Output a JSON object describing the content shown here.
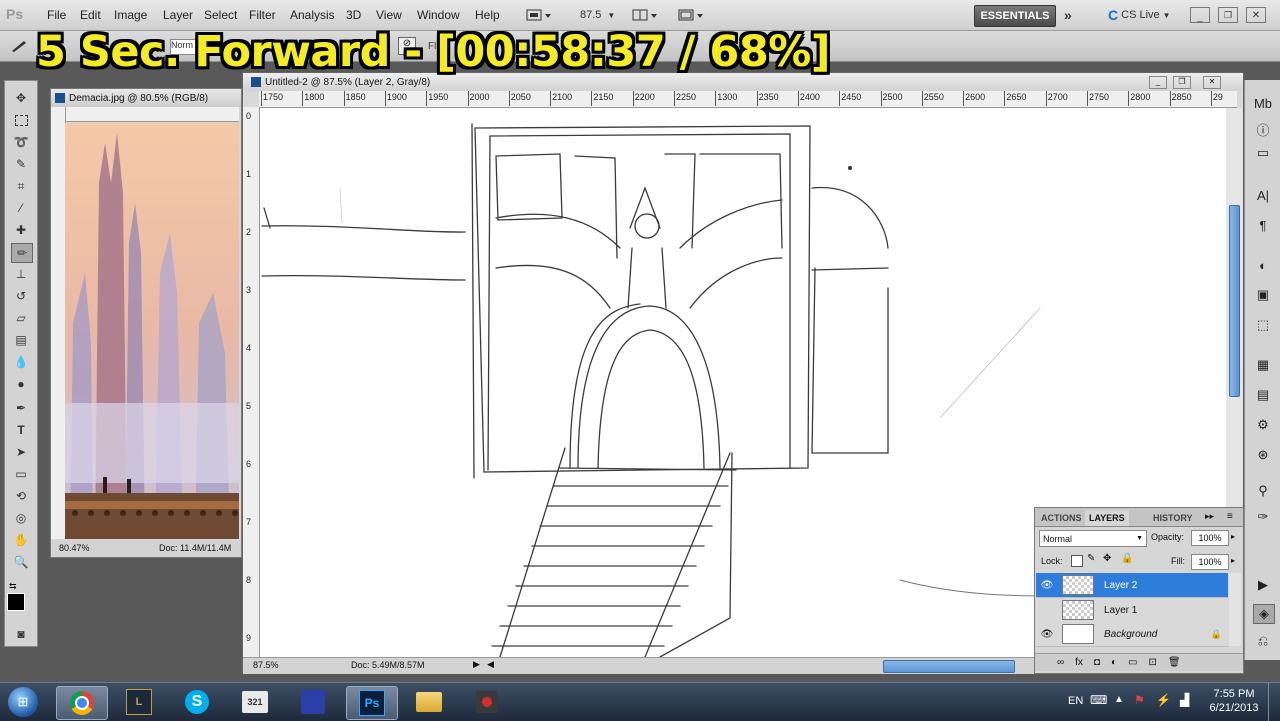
{
  "overlay": {
    "text": "5 Sec. Forward - [00:58:37 / 68%]"
  },
  "menubar": {
    "logo": "Ps",
    "items": [
      "File",
      "Edit",
      "Image",
      "Layer",
      "Select",
      "Filter",
      "Analysis",
      "3D",
      "View",
      "Window",
      "Help"
    ],
    "zoom": "87.5",
    "workspace": "ESSENTIALS",
    "cslive": "CS Live"
  },
  "optbar": {
    "mode": "Norm",
    "flow": "Flo"
  },
  "reference_window": {
    "title": "Demacia.jpg @ 80.5% (RGB/8)",
    "zoom": "80.47%",
    "doc": "Doc: 11.4M/11.4M"
  },
  "document_window": {
    "title": "Untitled-2 @ 87.5% (Layer 2, Gray/8)",
    "zoom": "87.5%",
    "doc": "Doc: 5.49M/8.57M",
    "ruler_labels": [
      "1750",
      "1800",
      "1850",
      "1900",
      "1950",
      "2000",
      "2050",
      "2100",
      "2150",
      "2200",
      "2250",
      "1300",
      "2350",
      "2400",
      "2450",
      "2500",
      "2550",
      "2600",
      "2650",
      "2700",
      "2750",
      "2800",
      "2850",
      "29"
    ],
    "vruler_labels": [
      "0",
      "1",
      "2",
      "3",
      "4",
      "5",
      "6",
      "7",
      "8",
      "9"
    ]
  },
  "layers_panel": {
    "tabs": [
      "ACTIONS",
      "LAYERS",
      "HISTORY"
    ],
    "blend_mode": "Normal",
    "opacity_label": "Opacity:",
    "opacity": "100%",
    "lock_label": "Lock:",
    "fill_label": "Fill:",
    "fill": "100%",
    "layers": [
      {
        "name": "Layer 2",
        "visible": true,
        "selected": true
      },
      {
        "name": "Layer 1",
        "visible": false,
        "selected": false
      },
      {
        "name": "Background",
        "visible": true,
        "selected": false
      }
    ]
  },
  "taskbar": {
    "apps": [
      "start-orb",
      "chrome",
      "league-of-legends",
      "skype",
      "media-player",
      "game-app",
      "photoshop",
      "file-explorer",
      "recorder"
    ],
    "lang": "EN",
    "time": "7:55 PM",
    "date": "6/21/2013"
  },
  "colors": {
    "accent": "#2f7ddb",
    "overlay_text": "#f3ec22"
  }
}
